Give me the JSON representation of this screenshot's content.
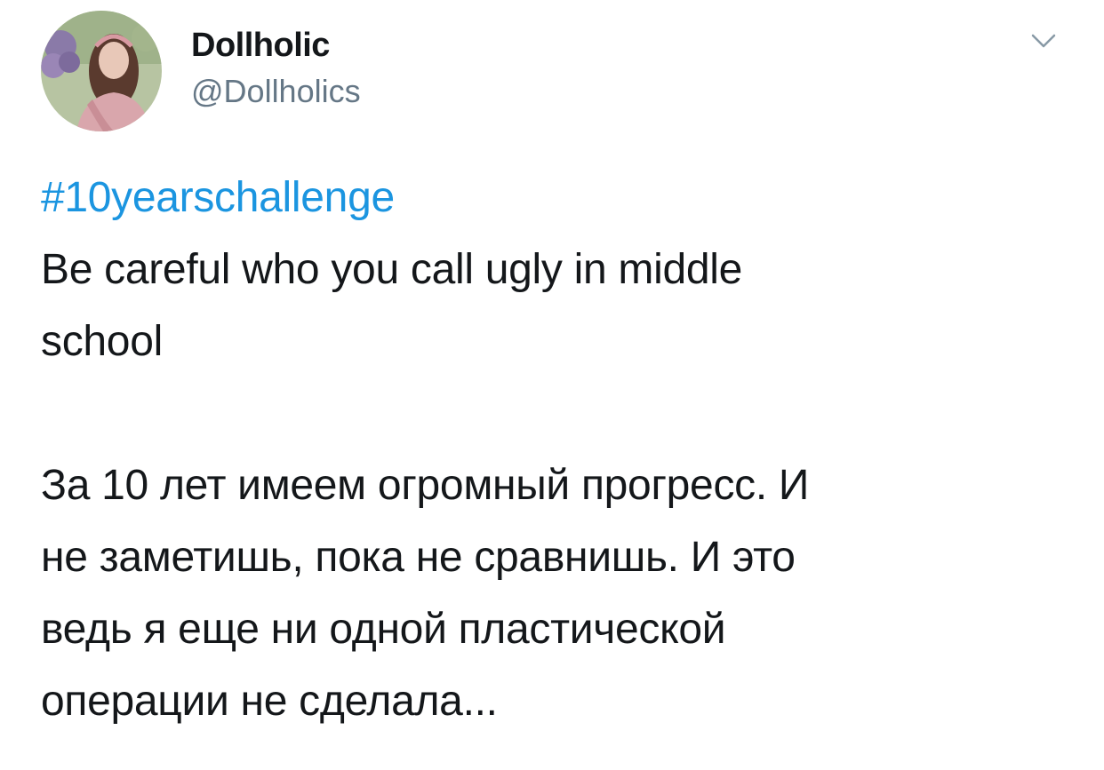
{
  "author": {
    "display_name": "Dollholic",
    "handle": "@Dollholics",
    "avatar_icon": "profile-photo"
  },
  "menu": {
    "icon": "chevron-down-icon"
  },
  "tweet": {
    "hashtag": "#10yearschallenge",
    "english_lines": [
      "Be careful who you call ugly in middle",
      "school"
    ],
    "russian_lines": [
      "За 10 лет имеем огромный прогресс. И",
      "не заметишь, пока не сравнишь. И это",
      "ведь я еще ни одной пластической",
      "операции не сделала..."
    ]
  },
  "colors": {
    "text": "#14171a",
    "secondary": "#657786",
    "link": "#1b95e0",
    "background": "#ffffff"
  }
}
